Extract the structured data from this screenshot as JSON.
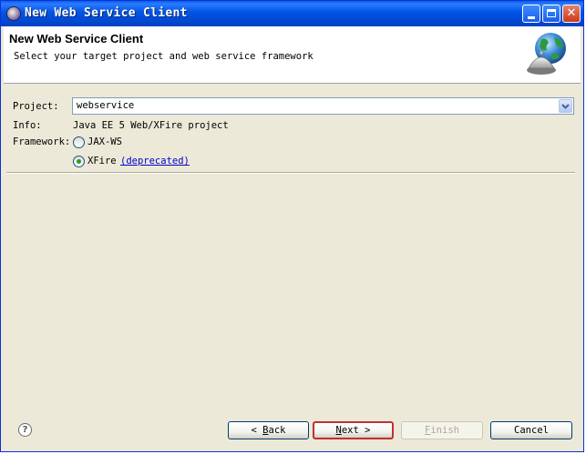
{
  "window": {
    "title": "New Web Service Client"
  },
  "banner": {
    "title": "New Web Service Client",
    "description": "Select your target project and web service framework"
  },
  "form": {
    "project_label": "Project:",
    "project_value": "webservice",
    "info_label": "Info:",
    "info_value": "Java EE 5 Web/XFire project",
    "framework_label": "Framework:",
    "options": [
      {
        "label": "JAX-WS",
        "selected": false
      },
      {
        "label": "XFire",
        "selected": true,
        "link": "(deprecated)"
      }
    ]
  },
  "footer": {
    "back": {
      "mnemonic": "B",
      "rest": "ack",
      "prefix": "< "
    },
    "next": {
      "mnemonic": "N",
      "rest": "ext",
      "suffix": " >"
    },
    "finish": {
      "mnemonic": "F",
      "rest": "inish",
      "disabled": true
    },
    "cancel": "Cancel"
  },
  "colors": {
    "title_bar": "#0054e3",
    "default_button_border": "#c03030",
    "link": "#0000cc"
  }
}
